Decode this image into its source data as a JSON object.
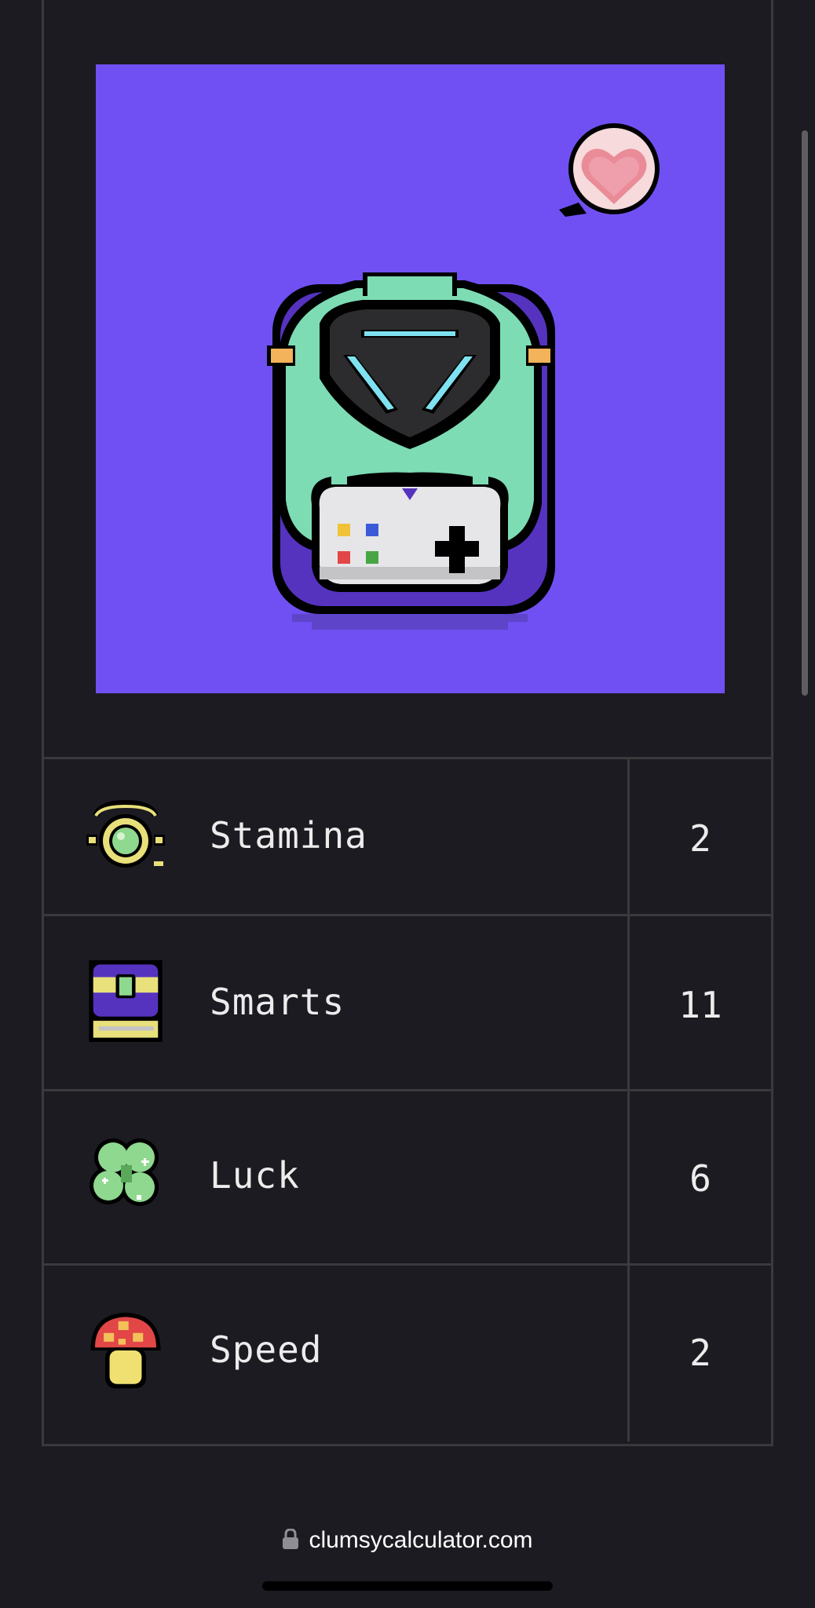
{
  "stats": [
    {
      "label": "Stamina",
      "value": "2",
      "icon": "amulet-icon"
    },
    {
      "label": "Smarts",
      "value": "11",
      "icon": "book-icon"
    },
    {
      "label": "Luck",
      "value": "6",
      "icon": "clover-icon"
    },
    {
      "label": "Speed",
      "value": "2",
      "icon": "mushroom-icon"
    }
  ],
  "artwork": {
    "background_color": "#7050f2",
    "character": "pixel-character-with-hood-and-controller",
    "speech_bubble": "heart-bubble-icon"
  },
  "browser": {
    "url": "clumsycalculator.com",
    "secure": true
  }
}
